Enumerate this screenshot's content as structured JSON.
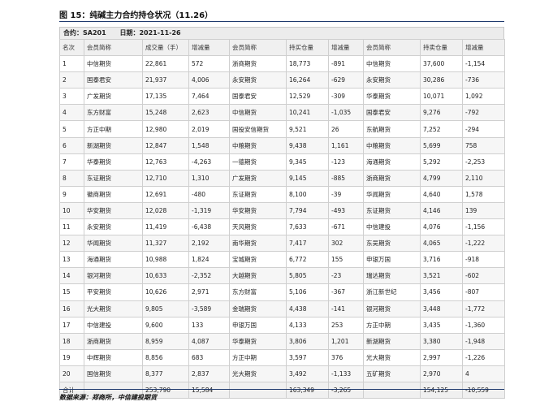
{
  "figure": {
    "title": "图 15：纯碱主力合约持仓状况（11.26）",
    "source": "数据来源：郑商所，中信建投期货"
  },
  "info": {
    "contract": "合约：SA201",
    "date": "日期：2021-11-26"
  },
  "table": {
    "headers": [
      "名次",
      "会员简称",
      "成交量（手）",
      "增减量",
      "会员简称",
      "持买仓量",
      "增减量",
      "会员简称",
      "持卖仓量",
      "增减量"
    ],
    "rows": [
      [
        "1",
        "中信期货",
        "22,861",
        "572",
        "浙商期货",
        "18,773",
        "-891",
        "中信期货",
        "37,600",
        "-1,154"
      ],
      [
        "2",
        "国泰君安",
        "21,937",
        "4,006",
        "永安期货",
        "16,264",
        "-629",
        "永安期货",
        "30,286",
        "-736"
      ],
      [
        "3",
        "广发期货",
        "17,135",
        "7,464",
        "国泰君安",
        "12,529",
        "-309",
        "华泰期货",
        "10,071",
        "1,092"
      ],
      [
        "4",
        "东方财富",
        "15,248",
        "2,623",
        "中信期货",
        "10,241",
        "-1,035",
        "国泰君安",
        "9,276",
        "-792"
      ],
      [
        "5",
        "方正中期",
        "12,980",
        "2,019",
        "国投安信期货",
        "9,521",
        "26",
        "东航期货",
        "7,252",
        "-294"
      ],
      [
        "6",
        "新湖期货",
        "12,847",
        "1,548",
        "中粮期货",
        "9,438",
        "1,161",
        "中粮期货",
        "5,699",
        "758"
      ],
      [
        "7",
        "华泰期货",
        "12,763",
        "-4,263",
        "一德期货",
        "9,345",
        "-123",
        "海通期货",
        "5,292",
        "-2,253"
      ],
      [
        "8",
        "东证期货",
        "12,710",
        "1,310",
        "广发期货",
        "9,145",
        "-885",
        "浙商期货",
        "4,799",
        "2,110"
      ],
      [
        "9",
        "徽商期货",
        "12,691",
        "-480",
        "东证期货",
        "8,100",
        "-39",
        "华闻期货",
        "4,640",
        "1,578"
      ],
      [
        "10",
        "华安期货",
        "12,028",
        "-1,319",
        "华安期货",
        "7,794",
        "-493",
        "东证期货",
        "4,146",
        "139"
      ],
      [
        "11",
        "永安期货",
        "11,419",
        "-6,438",
        "天风期货",
        "7,633",
        "-671",
        "中信建投",
        "4,076",
        "-1,156"
      ],
      [
        "12",
        "华闻期货",
        "11,327",
        "2,192",
        "南华期货",
        "7,417",
        "302",
        "东吴期货",
        "4,065",
        "-1,222"
      ],
      [
        "13",
        "海通期货",
        "10,988",
        "1,824",
        "宝城期货",
        "6,772",
        "155",
        "申银万国",
        "3,716",
        "-918"
      ],
      [
        "14",
        "银河期货",
        "10,633",
        "-2,352",
        "大越期货",
        "5,805",
        "-23",
        "瑞达期货",
        "3,521",
        "-602"
      ],
      [
        "15",
        "平安期货",
        "10,626",
        "2,971",
        "东方财富",
        "5,106",
        "-367",
        "浙江新世纪",
        "3,456",
        "-807"
      ],
      [
        "16",
        "光大期货",
        "9,805",
        "-3,589",
        "金瑞期货",
        "4,438",
        "-141",
        "银河期货",
        "3,448",
        "-1,772"
      ],
      [
        "17",
        "中信建投",
        "9,600",
        "133",
        "申银万国",
        "4,133",
        "253",
        "方正中期",
        "3,435",
        "-1,360"
      ],
      [
        "18",
        "浙商期货",
        "8,959",
        "4,087",
        "华泰期货",
        "3,806",
        "1,201",
        "新湖期货",
        "3,380",
        "-1,948"
      ],
      [
        "19",
        "中辉期货",
        "8,856",
        "683",
        "方正中期",
        "3,597",
        "376",
        "光大期货",
        "2,997",
        "-1,226"
      ],
      [
        "20",
        "国信期货",
        "8,377",
        "2,837",
        "光大期货",
        "3,492",
        "-1,133",
        "五矿期货",
        "2,970",
        "4"
      ]
    ],
    "total": [
      "合计",
      "",
      "253,790",
      "15,584",
      "",
      "163,349",
      "-3,265",
      "",
      "154,125",
      "-10,559"
    ]
  }
}
